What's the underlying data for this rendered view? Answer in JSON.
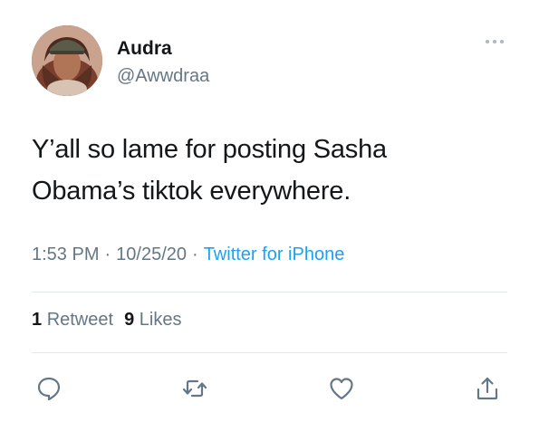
{
  "user": {
    "name": "Audra",
    "handle": "@Awwdraa"
  },
  "tweet": {
    "lines": [
      "Y’all so lame for posting Sasha",
      "Obama’s tiktok everywhere."
    ],
    "time": "1:53 PM",
    "separator": "·",
    "date": "10/25/20",
    "source": "Twitter for iPhone"
  },
  "stats": {
    "retweets_count": "1",
    "retweets_label": "Retweet",
    "likes_count": "9",
    "likes_label": "Likes"
  },
  "icons": {
    "more": "more-dots-icon",
    "reply": "reply-icon",
    "retweet": "retweet-icon",
    "like": "heart-icon",
    "share": "share-icon"
  },
  "colors": {
    "text_primary": "#14171a",
    "text_secondary": "#657786",
    "link": "#1da1f2",
    "divider": "#e1e8ed"
  }
}
